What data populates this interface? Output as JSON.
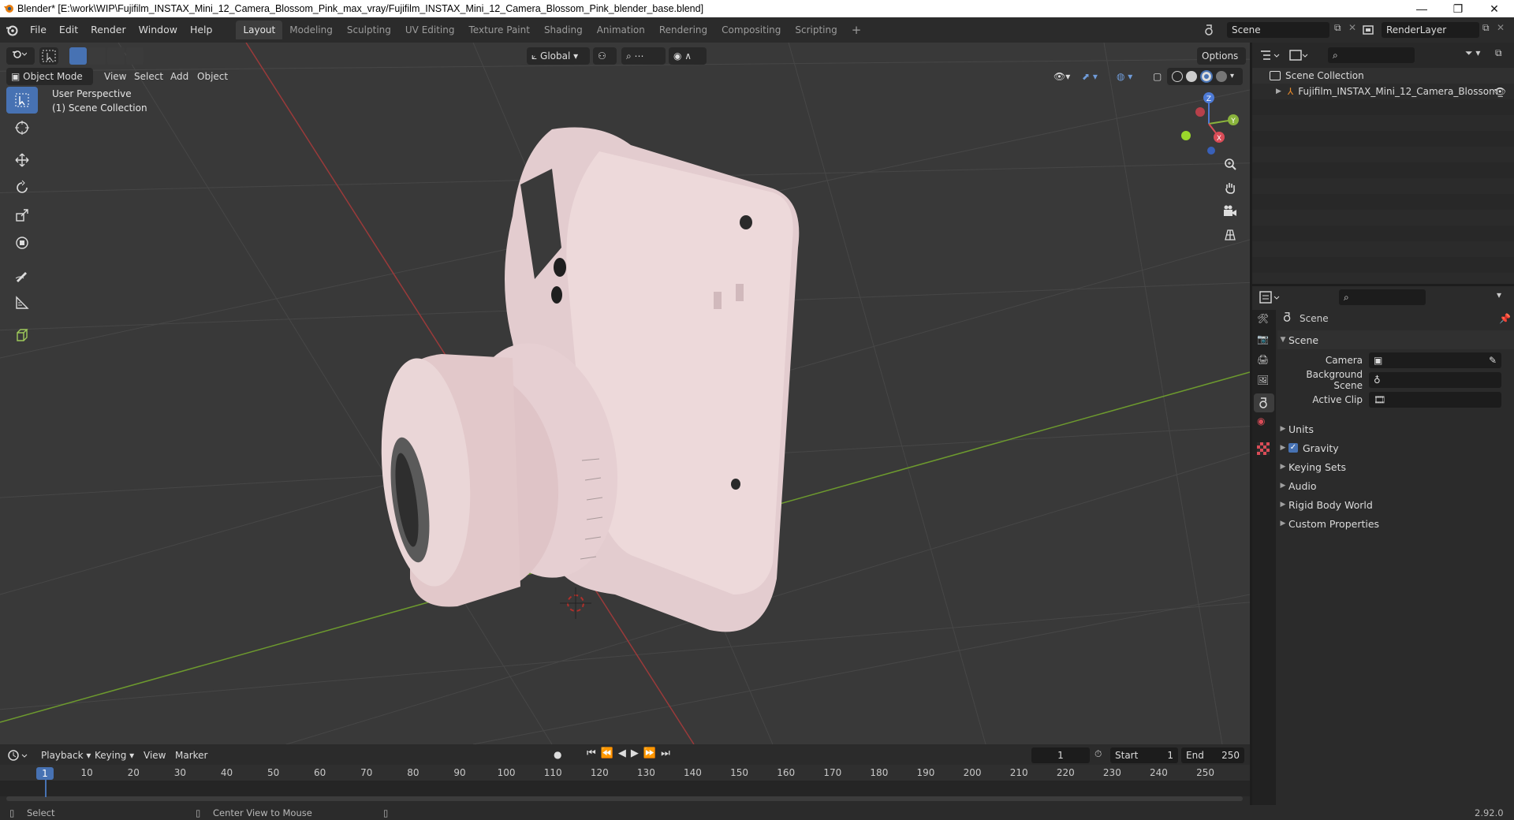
{
  "window": {
    "title": "Blender* [E:\\work\\WIP\\Fujifilm_INSTAX_Mini_12_Camera_Blossom_Pink_max_vray/Fujifilm_INSTAX_Mini_12_Camera_Blossom_Pink_blender_base.blend]",
    "controls": [
      "—",
      "❐",
      "✕"
    ]
  },
  "menubar": {
    "items": [
      "File",
      "Edit",
      "Render",
      "Window",
      "Help"
    ]
  },
  "workspaces": {
    "tabs": [
      "Layout",
      "Modeling",
      "Sculpting",
      "UV Editing",
      "Texture Paint",
      "Shading",
      "Animation",
      "Rendering",
      "Compositing",
      "Scripting"
    ],
    "active": "Layout",
    "add": "+"
  },
  "scene_selector": {
    "value": "Scene"
  },
  "view_layer_selector": {
    "value": "RenderLayer"
  },
  "viewport": {
    "mode": "Object Mode",
    "menus": [
      "View",
      "Select",
      "Add",
      "Object"
    ],
    "transform_orientation": "Global",
    "options_label": "Options",
    "overlay_text": [
      "User Perspective",
      "(1) Scene Collection"
    ],
    "gizmo_axes": {
      "x": "X",
      "y": "Y",
      "z": "Z"
    },
    "colors": {
      "background": "#393939",
      "grid": "#474747",
      "x_axis": "#9a3a3a",
      "y_axis": "#6d9a2e",
      "accent": "#4772b3"
    }
  },
  "outliner": {
    "root": "Scene Collection",
    "items": [
      {
        "label": "Fujifilm_INSTAX_Mini_12_Camera_Blossom_"
      }
    ]
  },
  "properties": {
    "context": "Scene",
    "panel_title": "Scene",
    "fields": [
      {
        "label": "Camera",
        "value": ""
      },
      {
        "label": "Background Scene",
        "value": ""
      },
      {
        "label": "Active Clip",
        "value": ""
      }
    ],
    "subpanels": [
      "Units",
      "Gravity",
      "Keying Sets",
      "Audio",
      "Rigid Body World",
      "Custom Properties"
    ],
    "gravity_checked": true
  },
  "timeline": {
    "menus": [
      "Playback",
      "Keying",
      "View",
      "Marker"
    ],
    "current_frame": "1",
    "start_label": "Start",
    "start": "1",
    "end_label": "End",
    "end": "250",
    "ruler": [
      "10",
      "20",
      "30",
      "40",
      "50",
      "60",
      "70",
      "80",
      "90",
      "100",
      "110",
      "120",
      "130",
      "140",
      "150",
      "160",
      "170",
      "180",
      "190",
      "200",
      "210",
      "220",
      "230",
      "240",
      "250"
    ],
    "playhead": "1"
  },
  "statusbar": {
    "left": "Select",
    "middle": "Center View to Mouse",
    "version": "2.92.0"
  }
}
